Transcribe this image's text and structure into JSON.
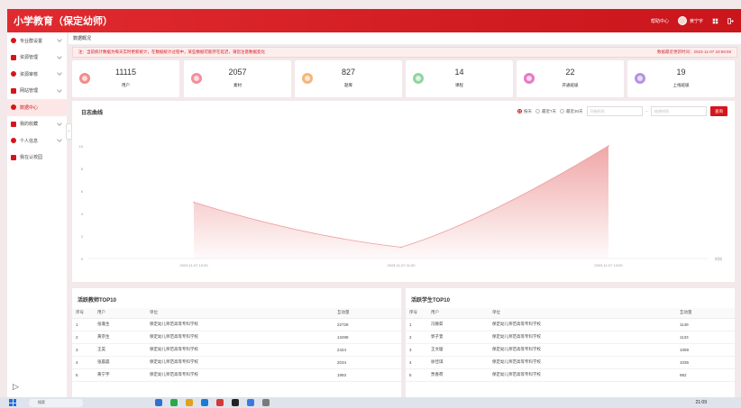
{
  "header": {
    "title": "小学教育（保定幼师）",
    "help_label": "帮助中心",
    "username": "黄宁宇"
  },
  "sidebar": {
    "items": [
      {
        "label": "专业群设置",
        "icon": "book-icon",
        "color": "#d6151b",
        "has_children": true
      },
      {
        "label": "资源管理",
        "icon": "folder-icon",
        "color": "#d6151b",
        "has_children": true
      },
      {
        "label": "资源审核",
        "icon": "list-icon",
        "color": "#d6151b",
        "has_children": true
      },
      {
        "label": "网站管理",
        "icon": "globe-icon",
        "color": "#d6151b",
        "has_children": true
      },
      {
        "label": "数据中心",
        "icon": "data-icon",
        "color": "#d6151b",
        "has_children": false,
        "active": true
      },
      {
        "label": "我的收藏",
        "icon": "star-icon",
        "color": "#d6151b",
        "has_children": true
      },
      {
        "label": "个人信息",
        "icon": "user-icon",
        "color": "#d6151b",
        "has_children": true
      },
      {
        "label": "我在认校园",
        "icon": "school-icon",
        "color": "#d6151b",
        "has_children": false
      }
    ]
  },
  "tabs": [
    {
      "label": "数据概况"
    }
  ],
  "notice": {
    "text": "注：当前统计数据为每天实时更新统计，在数据统计过程中，某些数据可能存在延迟，请您注意数据变化",
    "update_label": "数据最近更新时间：2023-11-07 23:59:59"
  },
  "stats": [
    {
      "value": "11115",
      "label": "用户",
      "color": "#f28c8c"
    },
    {
      "value": "2057",
      "label": "素材",
      "color": "#f58d9c"
    },
    {
      "value": "827",
      "label": "题库",
      "color": "#f5b57a"
    },
    {
      "value": "14",
      "label": "课程",
      "color": "#8fd6a0"
    },
    {
      "value": "22",
      "label": "开通班级",
      "color": "#e57bc7"
    },
    {
      "value": "19",
      "label": "上线班级",
      "color": "#b690e6"
    }
  ],
  "chart_panel": {
    "title": "日志曲线",
    "filters": [
      "按天",
      "最近7天",
      "最近30天"
    ],
    "active_filter": 0,
    "start_placeholder": "开始时间",
    "end_placeholder": "结束时间",
    "search_label": "查询"
  },
  "chart_data": {
    "type": "area",
    "x": [
      "2023-11-07 10:00",
      "2023-11-07 11:00",
      "2023-11-07 13:00"
    ],
    "values": [
      5,
      1,
      10
    ],
    "xlabel": "时间",
    "ylim": [
      0,
      10
    ],
    "yticks": [
      0,
      2,
      4,
      6,
      8,
      10
    ],
    "grid": false,
    "color": "#ee9d9d"
  },
  "teachers": {
    "title": "活跃教师TOP10",
    "headers": [
      "序号",
      "用户",
      "单位",
      "互动量"
    ],
    "rows": [
      [
        "1",
        "张蓬生",
        "保定幼儿师范高等专科学校",
        "22728"
      ],
      [
        "2",
        "黄宗生",
        "保定幼儿师范高等专科学校",
        "13498"
      ],
      [
        "3",
        "王昊",
        "保定幼儿师范高等专科学校",
        "2424"
      ],
      [
        "4",
        "张晨晨",
        "保定幼儿师范高等专科学校",
        "2034"
      ],
      [
        "5",
        "黄宁宇",
        "保定幼儿师范高等专科学校",
        "1993"
      ]
    ]
  },
  "students": {
    "title": "活跃学生TOP10",
    "headers": [
      "序号",
      "用户",
      "单位",
      "互动量"
    ],
    "rows": [
      [
        "1",
        "冯静茹",
        "保定幼儿师范高等专科学校",
        "1149"
      ],
      [
        "2",
        "郭子萱",
        "保定幼儿师范高等专科学校",
        "1133"
      ],
      [
        "3",
        "王文璇",
        "保定幼儿师范高等专科学校",
        "1069"
      ],
      [
        "4",
        "徐佳琪",
        "保定幼儿师范高等专科学校",
        "1036"
      ],
      [
        "5",
        "贾春荷",
        "保定幼儿师范高等专科学校",
        "982"
      ]
    ]
  },
  "taskbar": {
    "search_placeholder": "搜索",
    "clock": "21:09"
  }
}
